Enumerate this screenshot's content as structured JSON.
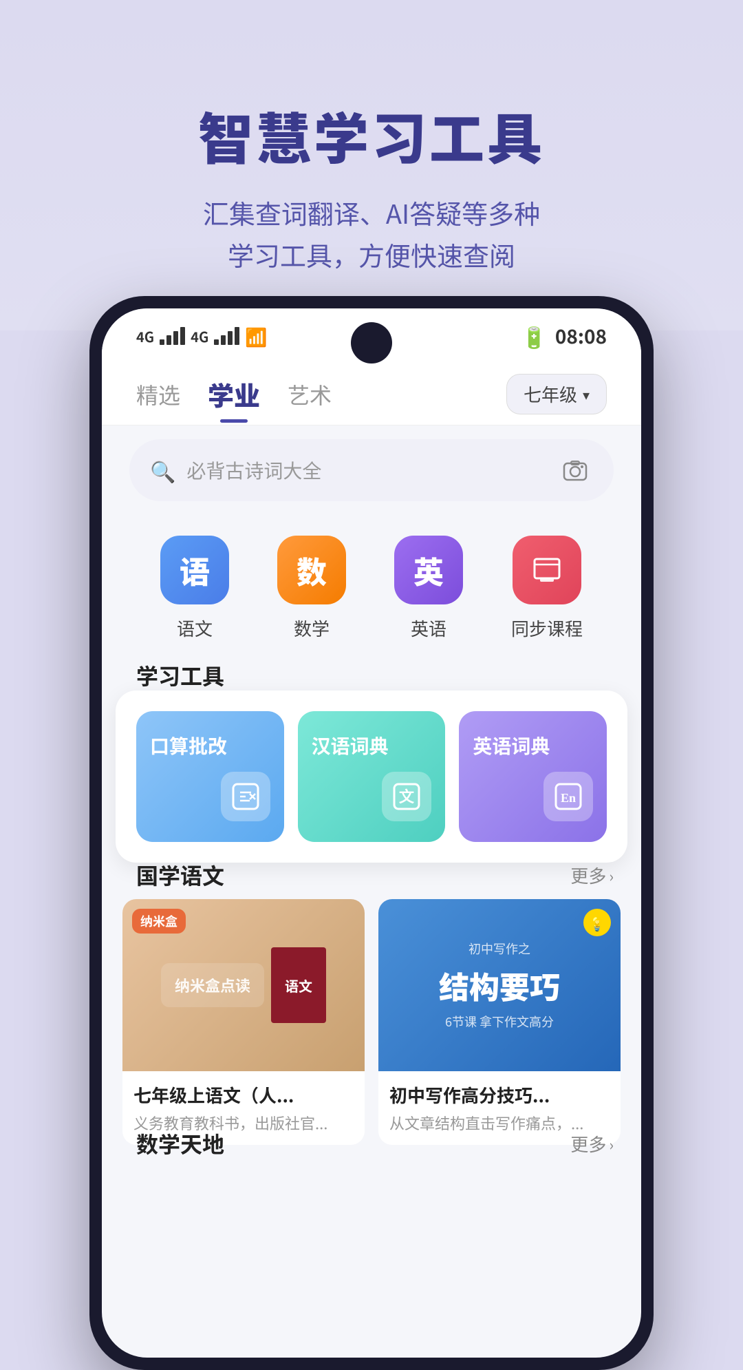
{
  "hero": {
    "title": "智慧学习工具",
    "subtitle_line1": "汇集查词翻译、AI答疑等多种",
    "subtitle_line2": "学习工具，方便快速查阅"
  },
  "status_bar": {
    "signals": [
      "4G",
      "4G"
    ],
    "time": "08:08"
  },
  "nav": {
    "tabs": [
      {
        "label": "精选",
        "active": false
      },
      {
        "label": "学业",
        "active": true
      },
      {
        "label": "艺术",
        "active": false
      }
    ],
    "grade": "七年级"
  },
  "search": {
    "placeholder": "必背古诗词大全"
  },
  "categories": [
    {
      "label": "语文",
      "icon": "语",
      "style": "cat-yuwen"
    },
    {
      "label": "数学",
      "icon": "数",
      "style": "cat-shuxue"
    },
    {
      "label": "英语",
      "icon": "英",
      "style": "cat-yingyu"
    },
    {
      "label": "同步课程",
      "icon": "📚",
      "style": "cat-kecheng"
    }
  ],
  "sections": {
    "tools_title": "学习工具",
    "guoxue_title": "国学语文",
    "guoxue_more": "更多",
    "shuxue_title": "数学天地",
    "shuxue_more": "更多"
  },
  "tools": [
    {
      "title": "口算批改",
      "icon": "⊞",
      "style": "tool-card-blue"
    },
    {
      "title": "汉语词典",
      "icon": "文",
      "style": "tool-card-cyan"
    },
    {
      "title": "英语词典",
      "icon": "En",
      "style": "tool-card-purple"
    }
  ],
  "books": [
    {
      "badge": "纳米盒",
      "title": "七年级上语文（人...",
      "subtitle": "义务教育教科书，出版社官...",
      "cover_text": "语文"
    },
    {
      "tip": "💡",
      "tag": "初中写作之",
      "title_big": "结构要巧",
      "sub": "6节课 拿下作文高分",
      "card_title": "初中写作高分技巧...",
      "card_subtitle": "从文章结构直击写作痛点，..."
    }
  ]
}
